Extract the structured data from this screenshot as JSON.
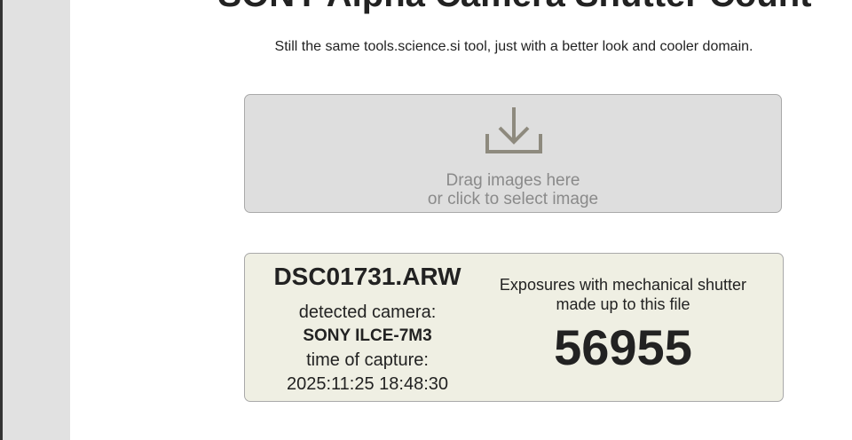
{
  "page": {
    "title": "SONY Alpha Camera Shutter Count",
    "subtitle": "Still the same tools.science.si tool, just with a better look and cooler domain."
  },
  "dropzone": {
    "icon": "download-icon",
    "line1": "Drag images here",
    "line2": "or click to select image"
  },
  "result": {
    "filename": "DSC01731.ARW",
    "camera_label": "detected camera:",
    "camera_value": "SONY ILCE-7M3",
    "time_label": "time of capture:",
    "time_value": "2025:11:25 18:48:30",
    "exposures_label_line1": "Exposures with mechanical shutter",
    "exposures_label_line2": "made up to this file",
    "shutter_count": "56955"
  },
  "colors": {
    "sidebar": "#e1e1e1",
    "dropzone_bg": "#dedede",
    "result_bg": "#efefe3",
    "border": "#a9a9a9",
    "muted_text": "#8a8a8a"
  }
}
